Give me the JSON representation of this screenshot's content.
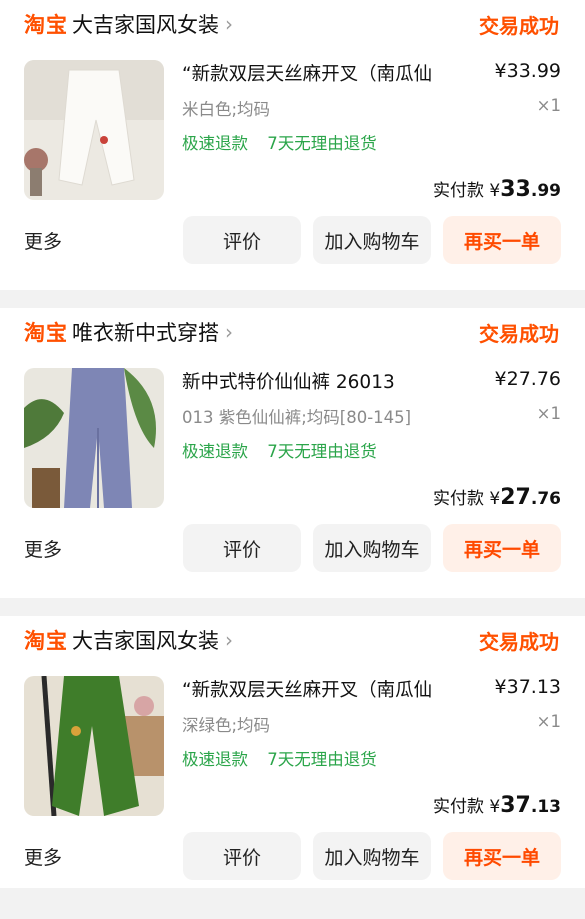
{
  "orders": [
    {
      "platform": "淘宝",
      "shop": "大吉家国风女装",
      "status": "交易成功",
      "title": "“新款双层天丝麻开叉（南瓜仙",
      "price": "¥33.99",
      "spec": "米白色;均码",
      "qty": "×1",
      "tags": [
        "极速退款",
        "7天无理由退货"
      ],
      "paid_label": "实付款",
      "paid_symbol": "¥",
      "paid_int": "33",
      "paid_dec": ".99",
      "more": "更多",
      "btn_review": "评价",
      "btn_cart": "加入购物车",
      "btn_rebuy": "再买一单",
      "thumb_color": "#f1ede6"
    },
    {
      "platform": "淘宝",
      "shop": "唯衣新中式穿搭",
      "status": "交易成功",
      "title": "新中式特价仙仙裤 26013",
      "price": "¥27.76",
      "spec": "013 紫色仙仙裤;均码[80-145]",
      "qty": "×1",
      "tags": [
        "极速退款",
        "7天无理由退货"
      ],
      "paid_label": "实付款",
      "paid_symbol": "¥",
      "paid_int": "27",
      "paid_dec": ".76",
      "more": "更多",
      "btn_review": "评价",
      "btn_cart": "加入购物车",
      "btn_rebuy": "再买一单",
      "thumb_color": "#7d86b3"
    },
    {
      "platform": "淘宝",
      "shop": "大吉家国风女装",
      "status": "交易成功",
      "title": "“新款双层天丝麻开叉（南瓜仙",
      "price": "¥37.13",
      "spec": "深绿色;均码",
      "qty": "×1",
      "tags": [
        "极速退款",
        "7天无理由退货"
      ],
      "paid_label": "实付款",
      "paid_symbol": "¥",
      "paid_int": "37",
      "paid_dec": ".13",
      "more": "更多",
      "btn_review": "评价",
      "btn_cart": "加入购物车",
      "btn_rebuy": "再买一单",
      "thumb_color": "#3f7d2a"
    }
  ]
}
